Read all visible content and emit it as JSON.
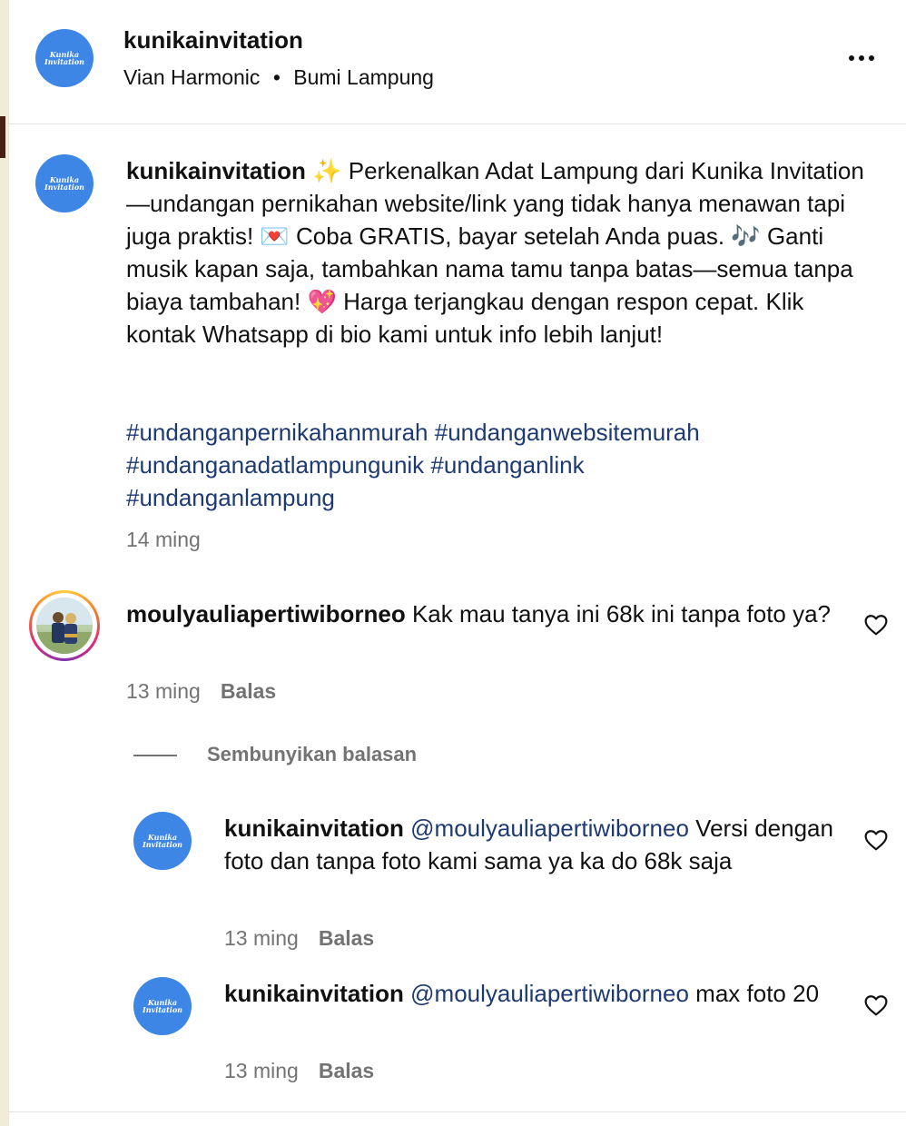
{
  "header": {
    "username": "kunikainvitation",
    "music": "Vian Harmonic",
    "location": "Bumi Lampung",
    "avatar_text": [
      "Kunika",
      "Invitation"
    ]
  },
  "caption": {
    "username": "kunikainvitation",
    "text": "✨ Perkenalkan Adat Lampung dari Kunika Invitation—undangan pernikahan website/link yang tidak hanya menawan tapi juga praktis! 💌 Coba GRATIS, bayar setelah Anda puas. 🎶 Ganti musik kapan saja, tambahkan nama tamu tanpa batas—semua tanpa biaya tambahan! 💖 Harga terjangkau dengan respon cepat. Klik kontak Whatsapp di bio kami untuk info lebih lanjut!",
    "hashtags": [
      "#undanganpernikahanmurah",
      "#undanganwebsitemurah",
      "#undanganadatlampungunik",
      "#undanganlink",
      "#undanganlampung"
    ],
    "time": "14 ming"
  },
  "comment": {
    "username": "moulyauliapertiwiborneo",
    "text": "Kak mau tanya ini 68k ini tanpa foto ya?",
    "time": "13 ming",
    "reply_label": "Balas"
  },
  "hide_replies_label": "Sembunyikan balasan",
  "replies": [
    {
      "username": "kunikainvitation",
      "mention": "@moulyauliapertiwiborneo",
      "text": "Versi dengan foto dan tanpa foto kami sama ya ka do 68k saja",
      "time": "13 ming",
      "reply_label": "Balas"
    },
    {
      "username": "kunikainvitation",
      "mention": "@moulyauliapertiwiborneo",
      "text": "max foto 20",
      "time": "13 ming",
      "reply_label": "Balas"
    }
  ],
  "icons": {
    "more": "more-options-icon",
    "like": "heart-icon"
  },
  "colors": {
    "avatar_blue": "#3d86e6",
    "link_blue": "#1e3a72",
    "meta_gray": "#737373"
  }
}
